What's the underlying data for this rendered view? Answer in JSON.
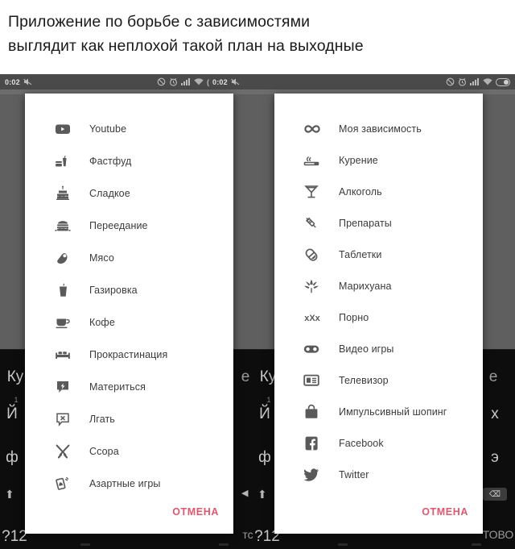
{
  "caption": {
    "line1": "Приложение по борьбе с зависимостями",
    "line2": "выглядит как неплохой такой план на выходные"
  },
  "status_bar": {
    "left_clock": "0:02",
    "mid_clock": "0:02",
    "separator": "(",
    "icons": [
      "mute-icon",
      "alarm-icon",
      "signal-icon",
      "wifi-icon",
      "battery-icon"
    ]
  },
  "background": {
    "keyboard_keys": [
      "Ку",
      "е",
      "Й",
      "ф",
      "х",
      "э",
      "?12",
      "тс",
      "ТОВО",
      "1"
    ],
    "shift_icon": "shift-arrow-icon",
    "backspace_icon": "backspace-icon",
    "left_arrow_icon": "left-arrow-icon"
  },
  "dialogs": [
    {
      "id": "left",
      "cancel_label": "ОТМЕНА",
      "items": [
        {
          "label": "Youtube",
          "icon": "youtube-icon"
        },
        {
          "label": "Фастфуд",
          "icon": "fastfood-icon"
        },
        {
          "label": "Сладкое",
          "icon": "cake-icon"
        },
        {
          "label": "Переедание",
          "icon": "burger-icon"
        },
        {
          "label": "Мясо",
          "icon": "meat-icon"
        },
        {
          "label": "Газировка",
          "icon": "soda-cup-icon"
        },
        {
          "label": "Кофе",
          "icon": "coffee-cup-icon"
        },
        {
          "label": "Прокрастинация",
          "icon": "bed-icon"
        },
        {
          "label": "Материться",
          "icon": "swear-bubble-icon"
        },
        {
          "label": "Лгать",
          "icon": "lie-bubble-icon"
        },
        {
          "label": "Ссора",
          "icon": "crossed-swords-icon"
        },
        {
          "label": "Азартные игры",
          "icon": "playing-cards-icon"
        }
      ]
    },
    {
      "id": "right",
      "cancel_label": "ОТМЕНА",
      "items": [
        {
          "label": "Моя зависимость",
          "icon": "infinity-icon"
        },
        {
          "label": "Курение",
          "icon": "cigarette-icon"
        },
        {
          "label": "Алкоголь",
          "icon": "cocktail-glass-icon"
        },
        {
          "label": "Препараты",
          "icon": "syringe-icon"
        },
        {
          "label": "Таблетки",
          "icon": "pill-icon"
        },
        {
          "label": "Марихуана",
          "icon": "cannabis-leaf-icon"
        },
        {
          "label": "Порно",
          "icon": "xxx-icon"
        },
        {
          "label": "Видео игры",
          "icon": "gamepad-icon"
        },
        {
          "label": "Телевизор",
          "icon": "television-icon"
        },
        {
          "label": "Импульсивный шопинг",
          "icon": "shopping-bag-icon"
        },
        {
          "label": "Facebook",
          "icon": "facebook-icon"
        },
        {
          "label": "Twitter",
          "icon": "twitter-bird-icon"
        }
      ]
    }
  ],
  "colors": {
    "accent_cancel": "#e2566e",
    "dialog_bg": "#ffffff",
    "scrim": "#5f5f5f",
    "statusbar": "#4a4a4a",
    "keyboard_bg": "#0d0d0d"
  }
}
